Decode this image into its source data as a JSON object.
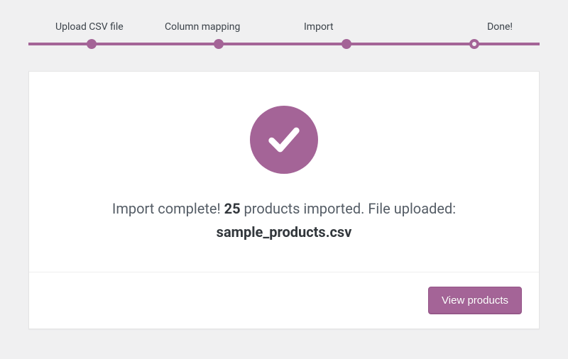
{
  "colors": {
    "accent": "#a46497"
  },
  "stepper": {
    "steps": [
      {
        "label": "Upload CSV file",
        "state": "complete"
      },
      {
        "label": "Column mapping",
        "state": "complete"
      },
      {
        "label": "Import",
        "state": "complete"
      },
      {
        "label": "Done!",
        "state": "current"
      }
    ]
  },
  "result": {
    "prefix": "Import complete! ",
    "count": "25",
    "mid": " products imported. File uploaded:",
    "filename": "sample_products.csv"
  },
  "actions": {
    "view_products_label": "View products"
  }
}
